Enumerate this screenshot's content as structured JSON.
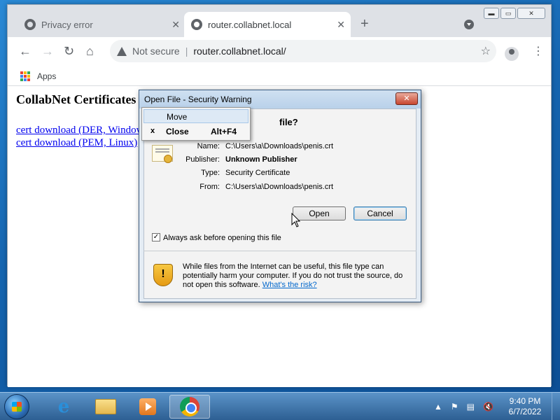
{
  "browser": {
    "tabs": [
      {
        "label": "Privacy error",
        "active": false
      },
      {
        "label": "router.collabnet.local",
        "active": true
      }
    ],
    "new_tab_label": "+",
    "tab_close_glyph": "✕",
    "nav": {
      "back": "←",
      "forward": "→",
      "reload": "↻",
      "home": "⌂"
    },
    "omnibox": {
      "security_label": "Not secure",
      "separator": "|",
      "url": "router.collabnet.local/"
    },
    "star_glyph": "☆",
    "menu_glyph": "⋮",
    "bookmarks": {
      "apps_label": "Apps"
    },
    "window_buttons": {
      "minimize": "▬",
      "maximize": "▭",
      "close": "✕"
    }
  },
  "page": {
    "title": "CollabNet Certificates",
    "links": [
      "cert download (DER, Windows)",
      "cert download (PEM, Linux)"
    ]
  },
  "dialog": {
    "title": "Open File - Security Warning",
    "close_glyph": "✕",
    "heading": "file?",
    "fields": [
      {
        "label": "Name:",
        "value": "C:\\Users\\a\\Downloads\\penis.crt",
        "bold": false
      },
      {
        "label": "Publisher:",
        "value": "Unknown Publisher",
        "bold": true
      },
      {
        "label": "Type:",
        "value": "Security Certificate",
        "bold": false
      },
      {
        "label": "From:",
        "value": "C:\\Users\\a\\Downloads\\penis.crt",
        "bold": false
      }
    ],
    "open_button": "Open",
    "cancel_button": "Cancel",
    "checkbox_label": "Always ask before opening this file",
    "checkbox_checked": true,
    "warning_text": "While files from the Internet can be useful, this file type can potentially harm your computer. If you do not trust the source, do not open this software. ",
    "warning_link": "What's the risk?",
    "shield_glyph": "!"
  },
  "context_menu": {
    "items": [
      {
        "label": "Move",
        "accelerator": "",
        "highlighted": true
      },
      {
        "label": "Close",
        "accelerator": "Alt+F4",
        "prefix": "x",
        "highlighted": false
      }
    ]
  },
  "taskbar": {
    "ie_glyph": "e",
    "tray": {
      "chevron": "▲",
      "flag": "⚑",
      "network": "▤",
      "volume": "🔇"
    },
    "clock": {
      "time": "9:40 PM",
      "date": "6/7/2022"
    }
  },
  "colors": {
    "apps_grid": [
      "#ea4335",
      "#fbbc05",
      "#34a853",
      "#4285f4",
      "#ea4335",
      "#fbbc05",
      "#34a853",
      "#4285f4",
      "#ea4335"
    ]
  }
}
